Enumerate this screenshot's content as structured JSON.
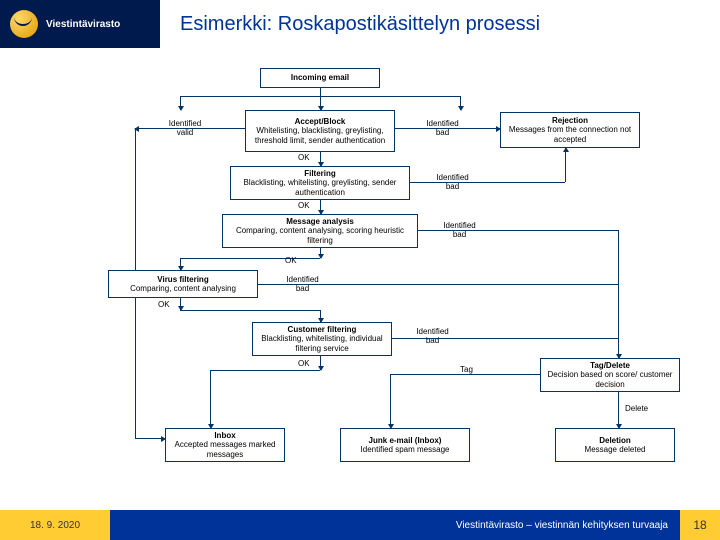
{
  "header": {
    "brand": "Viestintävirasto",
    "title": "Esimerkki: Roskapostikäsittelyn prosessi"
  },
  "nodes": {
    "incoming": {
      "t": "Incoming email"
    },
    "accept": {
      "t": "Accept/Block",
      "d": "Whitelisting, blacklisting, greylisting, threshold limit, sender authentication"
    },
    "rejection": {
      "t": "Rejection",
      "d": "Messages from the connection not accepted"
    },
    "filtering": {
      "t": "Filtering",
      "d": "Blacklisting, whitelisting, greylisting, sender authentication"
    },
    "msganal": {
      "t": "Message analysis",
      "d": "Comparing, content analysing, scoring heuristic filtering"
    },
    "virus": {
      "t": "Virus filtering",
      "d": "Comparing, content analysing"
    },
    "customer": {
      "t": "Customer filtering",
      "d": "Blacklisting, whitelisting, individual filtering service"
    },
    "tagdel": {
      "t": "Tag/Delete",
      "d": "Decision based on score/ customer decision"
    },
    "inbox": {
      "t": "Inbox",
      "d": "Accepted messages marked messages"
    },
    "junk": {
      "t": "Junk e-mail (Inbox)",
      "d": "Identified spam message"
    },
    "deletion": {
      "t": "Deletion",
      "d": "Message deleted"
    }
  },
  "labels": {
    "idvalid": "Identified\nvalid",
    "idbad": "Identified\nbad",
    "ok": "OK",
    "tag": "Tag",
    "delete": "Delete"
  },
  "footer": {
    "date": "18. 9. 2020",
    "slogan": "Viestintävirasto – viestinnän kehityksen turvaaja",
    "page": "18"
  }
}
